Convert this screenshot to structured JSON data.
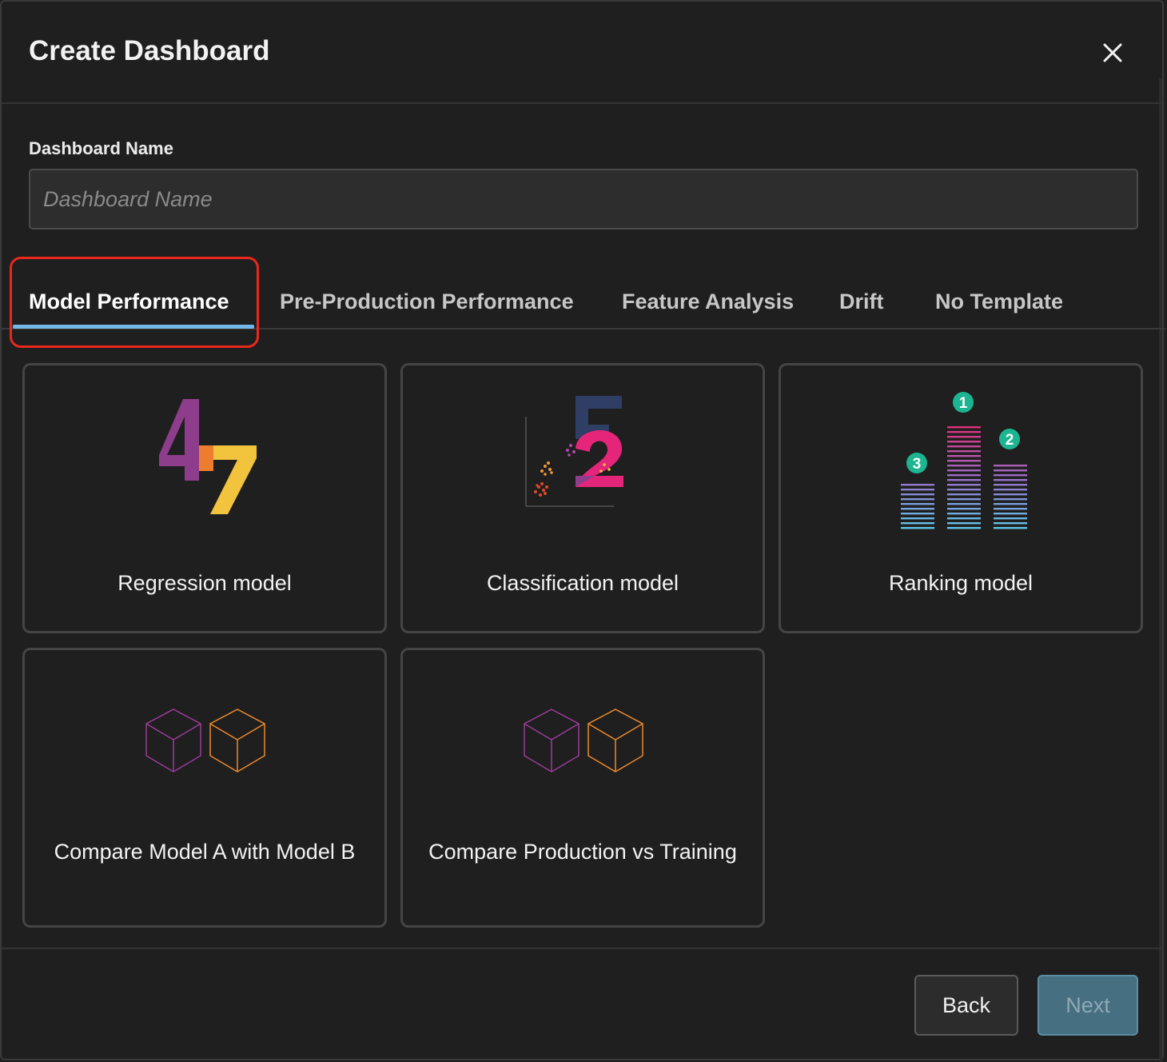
{
  "dialog": {
    "title": "Create Dashboard",
    "close_icon": "close-icon"
  },
  "form": {
    "name_label": "Dashboard Name",
    "name_placeholder": "Dashboard Name",
    "name_value": ""
  },
  "tabs": [
    {
      "label": "Model Performance",
      "active": true
    },
    {
      "label": "Pre-Production Performance",
      "active": false
    },
    {
      "label": "Feature Analysis",
      "active": false
    },
    {
      "label": "Drift",
      "active": false
    },
    {
      "label": "No Template",
      "active": false
    }
  ],
  "templates": [
    {
      "label": "Regression model",
      "icon": "regression-numbers-icon"
    },
    {
      "label": "Classification model",
      "icon": "classification-scatter-icon"
    },
    {
      "label": "Ranking model",
      "icon": "ranking-bars-icon",
      "ranks": [
        "1",
        "2",
        "3"
      ]
    },
    {
      "label": "Compare Model A with Model B",
      "icon": "cubes-compare-icon"
    },
    {
      "label": "Compare Production vs Training",
      "icon": "cubes-compare-icon"
    }
  ],
  "footer": {
    "back_label": "Back",
    "next_label": "Next"
  },
  "colors": {
    "accent": "#73b7e6",
    "highlight": "#e8291c",
    "next_bg": "#466f81",
    "rank_badge": "#1db591"
  }
}
